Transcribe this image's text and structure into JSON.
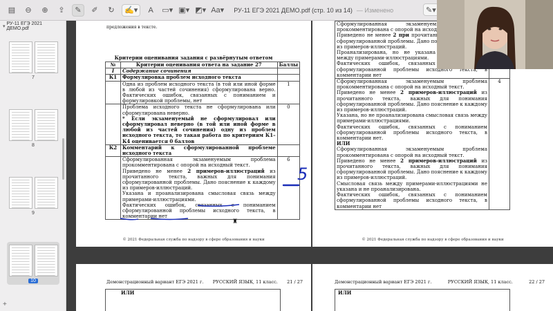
{
  "toolbar": {
    "title": "РУ-11 ЕГЭ 2021 ДЕМО.pdf (стр. 10 из 14)",
    "status": "— Изменено"
  },
  "sidebar": {
    "file_name": "РУ-11 ЕГЭ 2021 ДЕМО.pdf",
    "thumbs": [
      {
        "label": "7"
      },
      {
        "label": "8"
      },
      {
        "label": "9"
      },
      {
        "label": "10"
      }
    ]
  },
  "left_page": {
    "top_fragment": "предложения в тексте.",
    "title": "Критерии оценивания задания с развёрнутым ответом",
    "headers": {
      "num": "№",
      "criteria": "Критерии оценивания ответа на задание 27",
      "points": "Баллы"
    },
    "section_num": "I",
    "section_title": "Содержание сочинения",
    "k1_code": "К1",
    "k1_title": "Формулировка проблем исходного текста",
    "k1_row1": "Одна из проблем исходного текста (в той или иной форме в любой из частей сочинения) сформулирована верно. Фактических ошибок, связанных с пониманием и формулировкой проблемы, нет",
    "k1_row1_pts": "1",
    "k1_row2": "Проблема исходного текста не сформулирована или сформулирована неверно.",
    "k1_row2_bold": "* Если экзаменуемый не сформулировал или сформулировал неверно (в той или иной форме в любой из частей сочинения) одну из проблем исходного текста, то такая работа по критериям К1–К4 оценивается 0 баллов",
    "k1_row2_pts": "0",
    "k2_code": "К2",
    "k2_title": "Комментарий к сформулированной проблеме исходного текста",
    "k2_row1": "Сформулированная экзаменуемым проблема прокомментирована с опорой на исходный текст.",
    "k2_row1_a": "Приведено не менее",
    "k2_row1_b": "2 примеров-иллюстраций",
    "k2_row1_c": "из прочитанного текста, важных для понимания сформулированной проблемы. Дано пояснение к каждому из примеров-иллюстраций.",
    "k2_row1_d": "Указана и проанализирована смысловая связь между примерами-иллюстрациями.",
    "k2_row1_e": "Фактических ошибок, связанных с пониманием сформулированной проблемы исходного текста, в комментарии нет",
    "k2_row1_pts": "6",
    "footer": "© 2021 Федеральная служба по надзору в сфере образования и науки"
  },
  "right_page": {
    "block1": "Сформулированная экзаменуемым проблема прокомментирована с опорой на исходный текст.",
    "block1_a": "Приведено не менее",
    "block1_b": "2 при",
    "block1_c": "прочитанного текста, важны сформулированной проблемы. Дано пояснение к каждому из примеров-иллюстраций.",
    "block1_d": "Проанализирована, но не указана смысловая связь между примерами-иллюстрациями.",
    "block1_e": "Фактических ошибок, связанных с пониманием сформулированной проблемы исходного текста, в комментарии нет",
    "block2": "Сформулированная экзаменуемым проблема прокомментирована с опорой на исходный текст.",
    "block2_a": "Приведено не менее",
    "block2_b": "2 примеров-иллюстраций",
    "block2_c": "из прочитанного текста, важных для понимания сформулированной проблемы. Дано пояснение к каждому из примеров-иллюстраций.",
    "block2_d": "Указана, но не проанализирована смысловая связь между примерами-иллюстрациями.",
    "block2_e": "Фактических ошибок, связанных с пониманием сформулированной проблемы исходного текста, в комментарии нет.",
    "ili": "ИЛИ",
    "block3": "Сформулированная экзаменуемым проблема прокомментирована с опорой на исходный текст.",
    "block3_a": "Приведено не менее",
    "block3_b": "2 примеров-иллюстраций",
    "block3_c": "из прочитанного текста, важных для понимания сформулированной проблемы. Дано пояснение к каждому из примеров-иллюстраций.",
    "block3_d": "Смысловая связь между примерами-иллюстрациями не указана и не проанализирована.",
    "block3_e": "Фактических ошибок, связанных с пониманием сформулированной проблемы исходного текста, в комментарии нет",
    "pts": "4",
    "footer": "© 2021 Федеральная служба по надзору в сфере образования и науки"
  },
  "bottom_left": {
    "head_left": "Демонстрационный вариант ЕГЭ 2021 г.",
    "head_mid": "РУССКИЙ ЯЗЫК, 11 класс.",
    "head_right": "21 / 27",
    "ili": "ИЛИ"
  },
  "bottom_right": {
    "head_left": "Демонстрационный вариант ЕГЭ 2021 г.",
    "head_mid": "РУССКИЙ ЯЗЫК, 11 класс.",
    "head_right": "22 / 27",
    "ili": "ИЛИ"
  },
  "annotation": {
    "score": "5"
  }
}
